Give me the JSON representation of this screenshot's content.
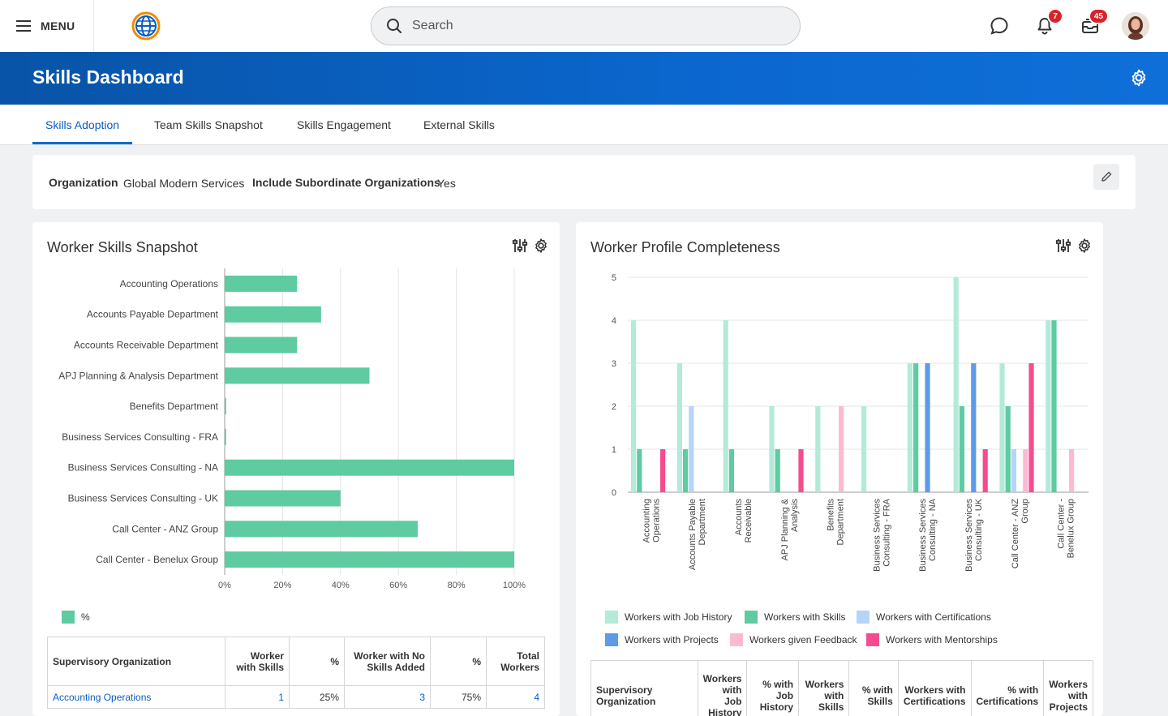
{
  "topbar": {
    "menu_label": "MENU",
    "search_placeholder": "Search",
    "notifications_count": "7",
    "inbox_count": "45"
  },
  "page": {
    "title": "Skills Dashboard"
  },
  "tabs": [
    {
      "label": "Skills Adoption",
      "active": true
    },
    {
      "label": "Team Skills Snapshot",
      "active": false
    },
    {
      "label": "Skills Engagement",
      "active": false
    },
    {
      "label": "External Skills",
      "active": false
    }
  ],
  "filters": {
    "org_label": "Organization",
    "org_value": "Global Modern Services",
    "sub_label": "Include Subordinate Organizations",
    "sub_value": "Yes"
  },
  "colors": {
    "brand_blue": "#0b67cf",
    "bar_green": "#5ecba1",
    "job_history": "#b3eada",
    "skills": "#5ecba1",
    "certifications": "#b5d4fa",
    "projects": "#5b9bea",
    "feedback": "#fbbad3",
    "mentorships": "#f54c8f"
  },
  "worker_skills_snapshot": {
    "title": "Worker Skills Snapshot",
    "legend_label": "%",
    "chart_data": {
      "type": "bar",
      "orientation": "horizontal",
      "categories": [
        "Accounting Operations",
        "Accounts Payable Department",
        "Accounts Receivable Department",
        "APJ Planning & Analysis Department",
        "Benefits Department",
        "Business Services Consulting - FRA",
        "Business Services Consulting - NA",
        "Business Services Consulting - UK",
        "Call Center - ANZ Group",
        "Call Center - Benelux Group"
      ],
      "values": [
        25,
        33.3,
        25,
        50,
        0.5,
        0.5,
        100,
        40,
        66.7,
        100
      ],
      "xlim": [
        0,
        100
      ],
      "xticks": [
        "0%",
        "20%",
        "40%",
        "60%",
        "80%",
        "100%"
      ],
      "grid": true,
      "legend_position": "bottom-left"
    },
    "table": {
      "headers": [
        "Supervisory Organization",
        "Worker with Skills",
        "%",
        "Worker with No Skills Added",
        "%",
        "Total Workers"
      ],
      "rows": [
        [
          "Accounting Operations",
          "1",
          "25%",
          "3",
          "75%",
          "4"
        ]
      ]
    }
  },
  "worker_profile_completeness": {
    "title": "Worker Profile Completeness",
    "chart_data": {
      "type": "bar",
      "categories": [
        "Accounting Operations",
        "Accounts Payable Department",
        "Accounts Receivable Depart...",
        "APJ Planning & Analysis Department",
        "Benefits Department",
        "Business Services Consulting - FRA",
        "Business Services Consulting - NA",
        "Business Services Consulting - UK",
        "Call Center - ANZ Group",
        "Call Center - Benelux Group"
      ],
      "series": [
        {
          "name": "Workers with Job History",
          "values": [
            4,
            3,
            4,
            2,
            2,
            2,
            3,
            5,
            3,
            4
          ]
        },
        {
          "name": "Workers with Skills",
          "values": [
            1,
            1,
            1,
            1,
            0,
            0,
            3,
            2,
            2,
            4
          ]
        },
        {
          "name": "Workers with Certifications",
          "values": [
            0,
            2,
            0,
            0,
            0,
            0,
            0,
            0,
            1,
            0
          ]
        },
        {
          "name": "Workers with Projects",
          "values": [
            0,
            0,
            0,
            0,
            0,
            0,
            3,
            3,
            0,
            0
          ]
        },
        {
          "name": "Workers given Feedback",
          "values": [
            0,
            0,
            0,
            0,
            2,
            0,
            0,
            0,
            1,
            1
          ]
        },
        {
          "name": "Workers with Mentorships",
          "values": [
            1,
            0,
            0,
            1,
            0,
            0,
            0,
            1,
            3,
            0
          ]
        }
      ],
      "ylim": [
        0,
        5
      ],
      "yticks": [
        "0",
        "1",
        "2",
        "3",
        "4",
        "5"
      ],
      "grid": true,
      "legend_position": "bottom"
    },
    "table": {
      "headers": [
        "Supervisory Organization",
        "Workers with Job History",
        "% with Job History",
        "Workers with Skills",
        "% with Skills",
        "Workers with Certifications",
        "% with Certifications",
        "Workers with Projects"
      ]
    }
  }
}
